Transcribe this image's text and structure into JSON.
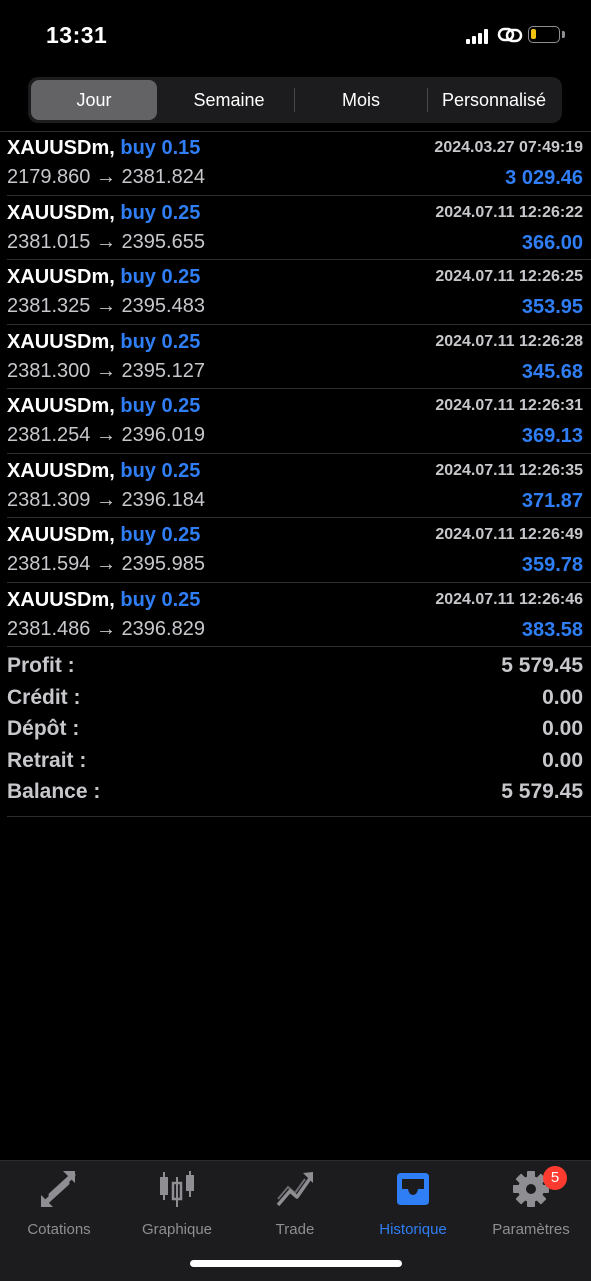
{
  "status_bar": {
    "time": "13:31"
  },
  "segments": [
    "Jour",
    "Semaine",
    "Mois",
    "Personnalisé"
  ],
  "selected_segment": "Jour",
  "trades": [
    {
      "symbol": "XAUUSDm,",
      "direction": "buy",
      "volume": "0.15",
      "prices": "2179.860 → 2381.824",
      "datetime": "2024.03.27 07:49:19",
      "profit": "3 029.46"
    },
    {
      "symbol": "XAUUSDm,",
      "direction": "buy",
      "volume": "0.25",
      "prices": "2381.015 → 2395.655",
      "datetime": "2024.07.11 12:26:22",
      "profit": "366.00"
    },
    {
      "symbol": "XAUUSDm,",
      "direction": "buy",
      "volume": "0.25",
      "prices": "2381.325 → 2395.483",
      "datetime": "2024.07.11 12:26:25",
      "profit": "353.95"
    },
    {
      "symbol": "XAUUSDm,",
      "direction": "buy",
      "volume": "0.25",
      "prices": "2381.300 → 2395.127",
      "datetime": "2024.07.11 12:26:28",
      "profit": "345.68"
    },
    {
      "symbol": "XAUUSDm,",
      "direction": "buy",
      "volume": "0.25",
      "prices": "2381.254 → 2396.019",
      "datetime": "2024.07.11 12:26:31",
      "profit": "369.13"
    },
    {
      "symbol": "XAUUSDm,",
      "direction": "buy",
      "volume": "0.25",
      "prices": "2381.309 → 2396.184",
      "datetime": "2024.07.11 12:26:35",
      "profit": "371.87"
    },
    {
      "symbol": "XAUUSDm,",
      "direction": "buy",
      "volume": "0.25",
      "prices": "2381.594 → 2395.985",
      "datetime": "2024.07.11 12:26:49",
      "profit": "359.78"
    },
    {
      "symbol": "XAUUSDm,",
      "direction": "buy",
      "volume": "0.25",
      "prices": "2381.486 → 2396.829",
      "datetime": "2024.07.11 12:26:46",
      "profit": "383.58"
    }
  ],
  "summary": [
    {
      "label": "Profit :",
      "value": "5 579.45"
    },
    {
      "label": "Crédit :",
      "value": "0.00"
    },
    {
      "label": "Dépôt :",
      "value": "0.00"
    },
    {
      "label": "Retrait :",
      "value": "0.00"
    },
    {
      "label": "Balance :",
      "value": "5 579.45"
    }
  ],
  "tabs": [
    {
      "label": "Cotations",
      "icon": "arrows-icon"
    },
    {
      "label": "Graphique",
      "icon": "candlestick-icon"
    },
    {
      "label": "Trade",
      "icon": "trend-icon"
    },
    {
      "label": "Historique",
      "icon": "inbox-icon"
    },
    {
      "label": "Paramètres",
      "icon": "gear-icon"
    }
  ],
  "active_tab": "Historique",
  "settings_badge": "5",
  "colors": {
    "accent": "#2f7ef5",
    "badge": "#ff3b30",
    "background": "#000000"
  }
}
